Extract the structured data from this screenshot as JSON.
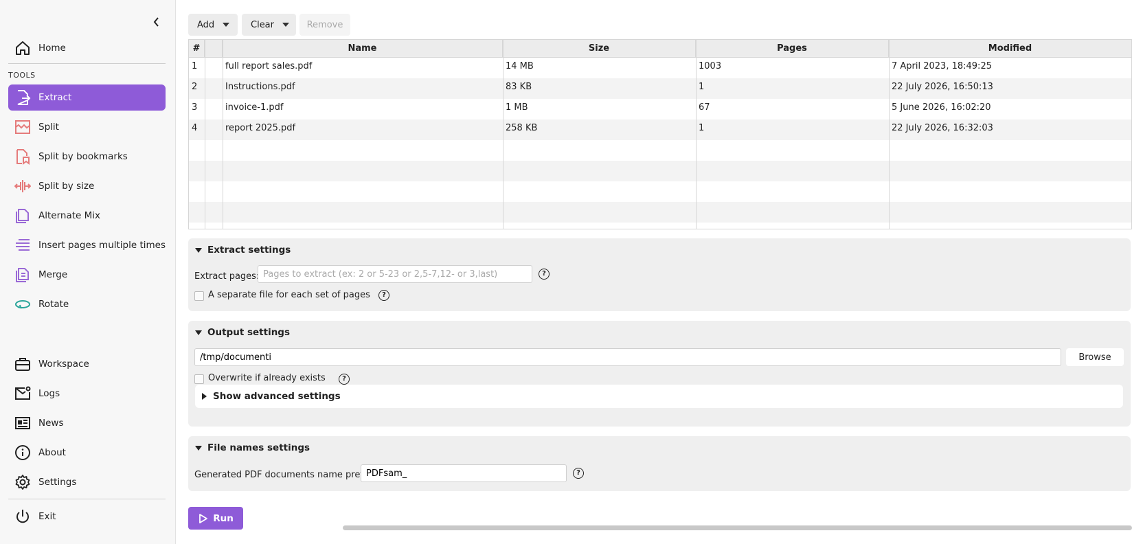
{
  "sidebar": {
    "collapse_icon": "chevron-left-icon",
    "tools_label": "TOOLS",
    "top_items": [
      {
        "label": "Home",
        "icon": "home-icon"
      }
    ],
    "tools": [
      {
        "label": "Extract",
        "icon": "extract-icon",
        "active": true
      },
      {
        "label": "Split",
        "icon": "split-icon"
      },
      {
        "label": "Split by bookmarks",
        "icon": "split-bookmarks-icon"
      },
      {
        "label": "Split by size",
        "icon": "split-size-icon"
      },
      {
        "label": "Alternate Mix",
        "icon": "alternate-mix-icon"
      },
      {
        "label": "Insert pages multiple times",
        "icon": "insert-pages-icon"
      },
      {
        "label": "Merge",
        "icon": "merge-icon"
      },
      {
        "label": "Rotate",
        "icon": "rotate-icon"
      }
    ],
    "bottom_items": [
      {
        "label": "Workspace",
        "icon": "briefcase-icon"
      },
      {
        "label": "Logs",
        "icon": "logs-icon"
      },
      {
        "label": "News",
        "icon": "news-icon"
      },
      {
        "label": "About",
        "icon": "info-icon"
      },
      {
        "label": "Settings",
        "icon": "gear-icon"
      }
    ],
    "exit_label": "Exit"
  },
  "toolbar": {
    "add_label": "Add",
    "clear_label": "Clear",
    "remove_label": "Remove"
  },
  "table": {
    "columns": [
      "#",
      "",
      "Name",
      "Size",
      "Pages",
      "Modified"
    ],
    "rows": [
      {
        "num": "1",
        "name": "full report sales.pdf",
        "size": "14 MB",
        "pages": "1003",
        "modified": "7 April 2023, 18:49:25"
      },
      {
        "num": "2",
        "name": "Instructions.pdf",
        "size": "83 KB",
        "pages": "1",
        "modified": "22 July 2026, 16:50:13"
      },
      {
        "num": "3",
        "name": "invoice-1.pdf",
        "size": "1 MB",
        "pages": "67",
        "modified": "5 June 2026, 16:02:20"
      },
      {
        "num": "4",
        "name": "report 2025.pdf",
        "size": "258 KB",
        "pages": "1",
        "modified": "22 July 2026, 16:32:03"
      }
    ]
  },
  "extract_settings": {
    "title": "Extract settings",
    "pages_label": "Extract pages:",
    "pages_placeholder": "Pages to extract (ex: 2 or 5-23 or 2,5-7,12- or 3,last)",
    "separate_label": "A separate file for each set of pages"
  },
  "output_settings": {
    "title": "Output settings",
    "path_value": "/tmp/documenti",
    "browse_label": "Browse",
    "overwrite_label": "Overwrite if already exists",
    "advanced_label": "Show advanced settings"
  },
  "file_names_settings": {
    "title": "File names settings",
    "prefix_label": "Generated PDF documents name prefix:",
    "prefix_value": "PDFsam_"
  },
  "run_label": "Run",
  "colors": {
    "accent": "#8e5bd8"
  }
}
